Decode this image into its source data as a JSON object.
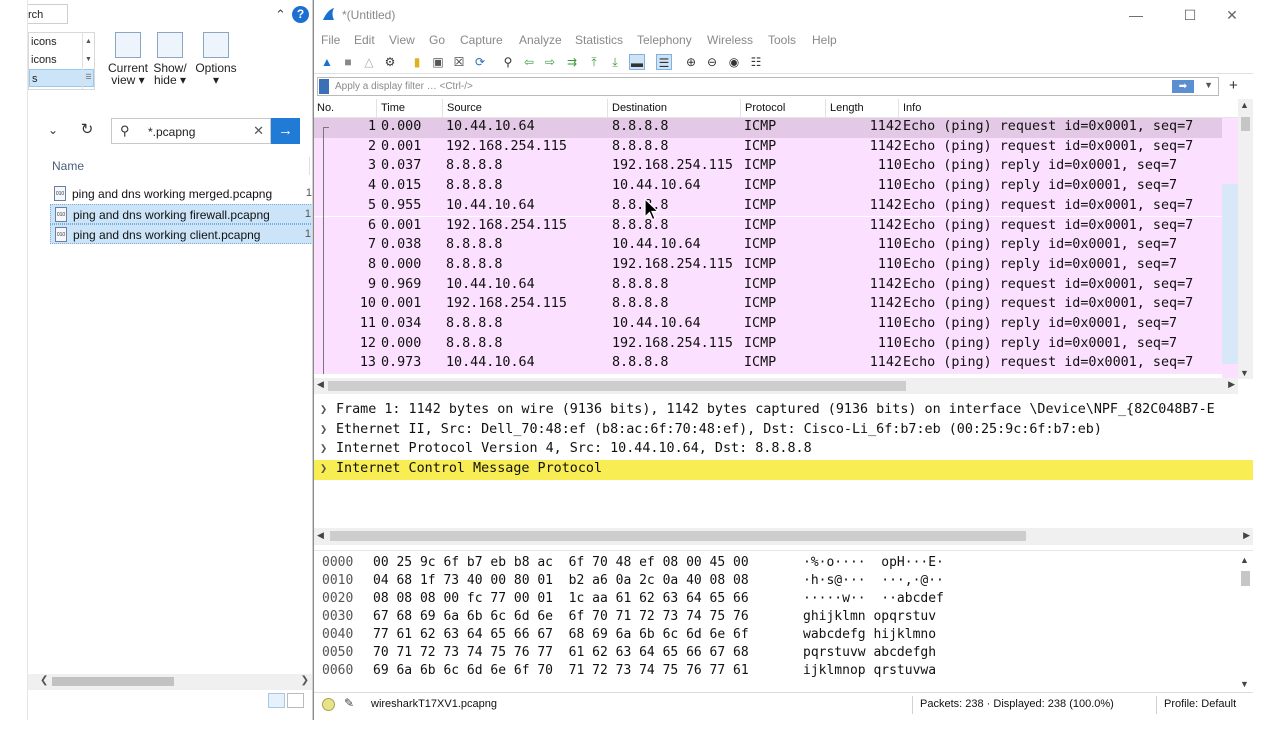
{
  "explorer": {
    "search_box_fragment": "rch",
    "layout_items": [
      {
        "label": "icons",
        "selected": false
      },
      {
        "label": "icons",
        "selected": false
      },
      {
        "label": "s",
        "selected": true
      }
    ],
    "ribbon": {
      "current_view": {
        "line1": "Current",
        "line2": "view"
      },
      "show_hide": {
        "line1": "Show/",
        "line2": "hide"
      },
      "options": {
        "line1": "Options"
      }
    },
    "search_value": "*.pcapng",
    "column_name": "Name",
    "files": [
      {
        "name": "ping and dns working merged.pcapng",
        "selected": false,
        "trail": "1"
      },
      {
        "name": "ping and dns working firewall.pcapng",
        "selected": true,
        "trail": "1"
      },
      {
        "name": "ping and dns working client.pcapng",
        "selected": true,
        "trail": "1"
      }
    ],
    "file_icon_text": "010"
  },
  "wireshark": {
    "title": "*(Untitled)",
    "menu": [
      "File",
      "Edit",
      "View",
      "Go",
      "Capture",
      "Analyze",
      "Statistics",
      "Telephony",
      "Wireless",
      "Tools",
      "Help"
    ],
    "filter_placeholder": "Apply a display filter … <Ctrl-/>",
    "columns": [
      "No.",
      "Time",
      "Source",
      "Destination",
      "Protocol",
      "Length",
      "Info"
    ],
    "packets": [
      {
        "no": "1",
        "time": "0.000",
        "src": "10.44.10.64",
        "dst": "8.8.8.8",
        "proto": "ICMP",
        "len": "1142",
        "info": "Echo (ping) request  id=0x0001, seq=7"
      },
      {
        "no": "2",
        "time": "0.001",
        "src": "192.168.254.115",
        "dst": "8.8.8.8",
        "proto": "ICMP",
        "len": "1142",
        "info": "Echo (ping) request  id=0x0001, seq=7"
      },
      {
        "no": "3",
        "time": "0.037",
        "src": "8.8.8.8",
        "dst": "192.168.254.115",
        "proto": "ICMP",
        "len": "110",
        "info": "Echo (ping) reply    id=0x0001, seq=7"
      },
      {
        "no": "4",
        "time": "0.015",
        "src": "8.8.8.8",
        "dst": "10.44.10.64",
        "proto": "ICMP",
        "len": "110",
        "info": "Echo (ping) reply    id=0x0001, seq=7"
      },
      {
        "no": "5",
        "time": "0.955",
        "src": "10.44.10.64",
        "dst": "8.8.8.8",
        "proto": "ICMP",
        "len": "1142",
        "info": "Echo (ping) request  id=0x0001, seq=7"
      },
      {
        "no": "6",
        "time": "0.001",
        "src": "192.168.254.115",
        "dst": "8.8.8.8",
        "proto": "ICMP",
        "len": "1142",
        "info": "Echo (ping) request  id=0x0001, seq=7"
      },
      {
        "no": "7",
        "time": "0.038",
        "src": "8.8.8.8",
        "dst": "10.44.10.64",
        "proto": "ICMP",
        "len": "110",
        "info": "Echo (ping) reply    id=0x0001, seq=7"
      },
      {
        "no": "8",
        "time": "0.000",
        "src": "8.8.8.8",
        "dst": "192.168.254.115",
        "proto": "ICMP",
        "len": "110",
        "info": "Echo (ping) reply    id=0x0001, seq=7"
      },
      {
        "no": "9",
        "time": "0.969",
        "src": "10.44.10.64",
        "dst": "8.8.8.8",
        "proto": "ICMP",
        "len": "1142",
        "info": "Echo (ping) request  id=0x0001, seq=7"
      },
      {
        "no": "10",
        "time": "0.001",
        "src": "192.168.254.115",
        "dst": "8.8.8.8",
        "proto": "ICMP",
        "len": "1142",
        "info": "Echo (ping) request  id=0x0001, seq=7"
      },
      {
        "no": "11",
        "time": "0.034",
        "src": "8.8.8.8",
        "dst": "10.44.10.64",
        "proto": "ICMP",
        "len": "110",
        "info": "Echo (ping) reply    id=0x0001, seq=7"
      },
      {
        "no": "12",
        "time": "0.000",
        "src": "8.8.8.8",
        "dst": "192.168.254.115",
        "proto": "ICMP",
        "len": "110",
        "info": "Echo (ping) reply    id=0x0001, seq=7"
      },
      {
        "no": "13",
        "time": "0.973",
        "src": "10.44.10.64",
        "dst": "8.8.8.8",
        "proto": "ICMP",
        "len": "1142",
        "info": "Echo (ping) request  id=0x0001, seq=7"
      }
    ],
    "selected_packet": "1",
    "details": [
      {
        "text": "Frame 1: 1142 bytes on wire (9136 bits), 1142 bytes captured (9136 bits) on interface \\Device\\NPF_{82C048B7-E",
        "highlight": false
      },
      {
        "text": "Ethernet II, Src: Dell_70:48:ef (b8:ac:6f:70:48:ef), Dst: Cisco-Li_6f:b7:eb (00:25:9c:6f:b7:eb)",
        "highlight": false
      },
      {
        "text": "Internet Protocol Version 4, Src: 10.44.10.64, Dst: 8.8.8.8",
        "highlight": false
      },
      {
        "text": "Internet Control Message Protocol",
        "highlight": true
      }
    ],
    "bytes": [
      {
        "offset": "0000",
        "hex": "00 25 9c 6f b7 eb b8 ac  6f 70 48 ef 08 00 45 00",
        "ascii": "·%·o····  opH···E·"
      },
      {
        "offset": "0010",
        "hex": "04 68 1f 73 40 00 80 01  b2 a6 0a 2c 0a 40 08 08",
        "ascii": "·h·s@···  ···,·@··"
      },
      {
        "offset": "0020",
        "hex": "08 08 08 00 fc 77 00 01  1c aa 61 62 63 64 65 66",
        "ascii": "·····w··  ··abcdef"
      },
      {
        "offset": "0030",
        "hex": "67 68 69 6a 6b 6c 6d 6e  6f 70 71 72 73 74 75 76",
        "ascii": "ghijklmn opqrstuv"
      },
      {
        "offset": "0040",
        "hex": "77 61 62 63 64 65 66 67  68 69 6a 6b 6c 6d 6e 6f",
        "ascii": "wabcdefg hijklmno"
      },
      {
        "offset": "0050",
        "hex": "70 71 72 73 74 75 76 77  61 62 63 64 65 66 67 68",
        "ascii": "pqrstuvw abcdefgh"
      },
      {
        "offset": "0060",
        "hex": "69 6a 6b 6c 6d 6e 6f 70  71 72 73 74 75 76 77 61",
        "ascii": "ijklmnop qrstuvwa"
      }
    ],
    "status": {
      "file": "wiresharkT17XV1.pcapng",
      "packets": "Packets: 238 · Displayed: 238 (100.0%)",
      "profile": "Profile: Default"
    },
    "colors": {
      "icmp_row": "#fce0ff",
      "selected_row": "#e3c9e6",
      "highlight_field": "#f8ed52",
      "accent": "#1f7bd6"
    }
  }
}
